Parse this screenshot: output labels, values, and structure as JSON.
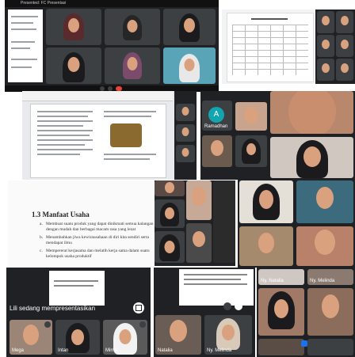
{
  "top_left": {
    "title": "Presented: FC Presentasi"
  },
  "middle_left": {
    "avatar_letter": "A",
    "tile_label": "Ramadhan"
  },
  "bottom_left_doc": {
    "heading": "1.3 Manfaat Usaha",
    "items": [
      "Membuat suatu produk yang dapat dinikmati semua kalangan dengan mudah dan berbagai macam rasa yang lezat",
      "Menambahkan jiwa kewirausahaan di diri kita sendiri serta mendapat ilmu",
      "Mempererat kerjasama dan melatih kerja sama dalam suatu kelompok usaha produktif"
    ],
    "list_markers": [
      "a.",
      "b.",
      "c."
    ]
  },
  "bottom_left_meet": {
    "presenting_text": "Lili sedang mempresentasikan",
    "tiles": [
      "Mega",
      "Intan",
      "Mirna"
    ]
  },
  "bottom_middle": {
    "tiles": [
      "Natalia",
      "Ny. Melinda"
    ]
  },
  "bottom_right": {
    "tiles": [
      "Ny. Natalia",
      "Ny. Melinda"
    ]
  },
  "colors": {
    "meet_bg": "#202124",
    "tile_bg": "#3c4043",
    "accent_blue": "#1a73e8",
    "teal_avatar": "#12a4af"
  }
}
